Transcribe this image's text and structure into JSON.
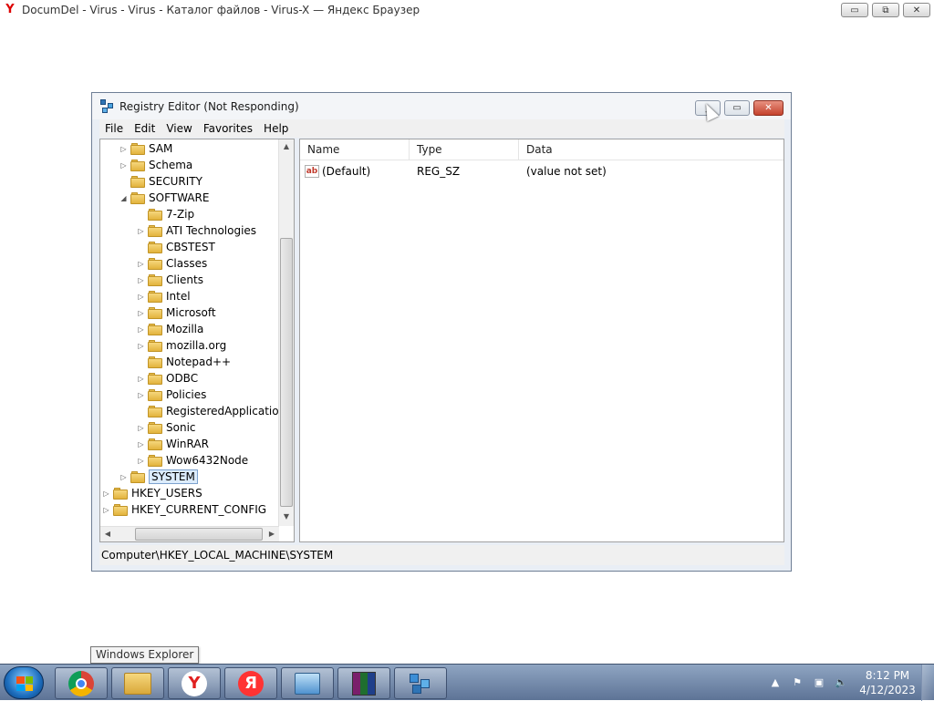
{
  "browser": {
    "title": "DocumDel - Virus - Virus - Каталог файлов - Virus-X — Яндекс Браузер",
    "logo": "Y",
    "minimize": "▭",
    "restore": "⧉",
    "close": "✕"
  },
  "regedit": {
    "title": "Registry Editor (Not Responding)",
    "controls": {
      "minimize": "_",
      "restore": "▭",
      "close": "✕"
    },
    "menu": [
      "File",
      "Edit",
      "View",
      "Favorites",
      "Help"
    ],
    "tree": [
      {
        "label": "SAM",
        "level": 1,
        "expander": "▷"
      },
      {
        "label": "Schema",
        "level": 1,
        "expander": "▷"
      },
      {
        "label": "SECURITY",
        "level": 1,
        "expander": ""
      },
      {
        "label": "SOFTWARE",
        "level": 1,
        "expander": "◢"
      },
      {
        "label": "7-Zip",
        "level": 2,
        "expander": ""
      },
      {
        "label": "ATI Technologies",
        "level": 2,
        "expander": "▷"
      },
      {
        "label": "CBSTEST",
        "level": 2,
        "expander": ""
      },
      {
        "label": "Classes",
        "level": 2,
        "expander": "▷"
      },
      {
        "label": "Clients",
        "level": 2,
        "expander": "▷"
      },
      {
        "label": "Intel",
        "level": 2,
        "expander": "▷"
      },
      {
        "label": "Microsoft",
        "level": 2,
        "expander": "▷"
      },
      {
        "label": "Mozilla",
        "level": 2,
        "expander": "▷"
      },
      {
        "label": "mozilla.org",
        "level": 2,
        "expander": "▷"
      },
      {
        "label": "Notepad++",
        "level": 2,
        "expander": ""
      },
      {
        "label": "ODBC",
        "level": 2,
        "expander": "▷"
      },
      {
        "label": "Policies",
        "level": 2,
        "expander": "▷"
      },
      {
        "label": "RegisteredApplications",
        "level": 2,
        "expander": ""
      },
      {
        "label": "Sonic",
        "level": 2,
        "expander": "▷"
      },
      {
        "label": "WinRAR",
        "level": 2,
        "expander": "▷"
      },
      {
        "label": "Wow6432Node",
        "level": 2,
        "expander": "▷"
      },
      {
        "label": "SYSTEM",
        "level": 1,
        "expander": "▷",
        "selected": true
      },
      {
        "label": "HKEY_USERS",
        "level": 0,
        "expander": "▷"
      },
      {
        "label": "HKEY_CURRENT_CONFIG",
        "level": 0,
        "expander": "▷"
      }
    ],
    "columns": [
      "Name",
      "Type",
      "Data"
    ],
    "values": [
      {
        "icon": "ab",
        "name": "(Default)",
        "type": "REG_SZ",
        "data": "(value not set)"
      }
    ],
    "status": "Computer\\HKEY_LOCAL_MACHINE\\SYSTEM"
  },
  "tooltip": "Windows Explorer",
  "taskbar": {
    "apps": [
      {
        "name": "chrome",
        "icon": "chrome-icon"
      },
      {
        "name": "explorer",
        "icon": "folder-icon"
      },
      {
        "name": "yandex-browser",
        "icon": "yandex-browser-icon",
        "glyph": "Y"
      },
      {
        "name": "yandex",
        "icon": "yandex-icon",
        "glyph": "Я"
      },
      {
        "name": "control-panel",
        "icon": "control-panel-icon"
      },
      {
        "name": "winrar",
        "icon": "winrar-icon"
      },
      {
        "name": "regedit",
        "icon": "regedit-icon"
      }
    ],
    "clock_time": "8:12 PM",
    "clock_date": "4/12/2023"
  }
}
